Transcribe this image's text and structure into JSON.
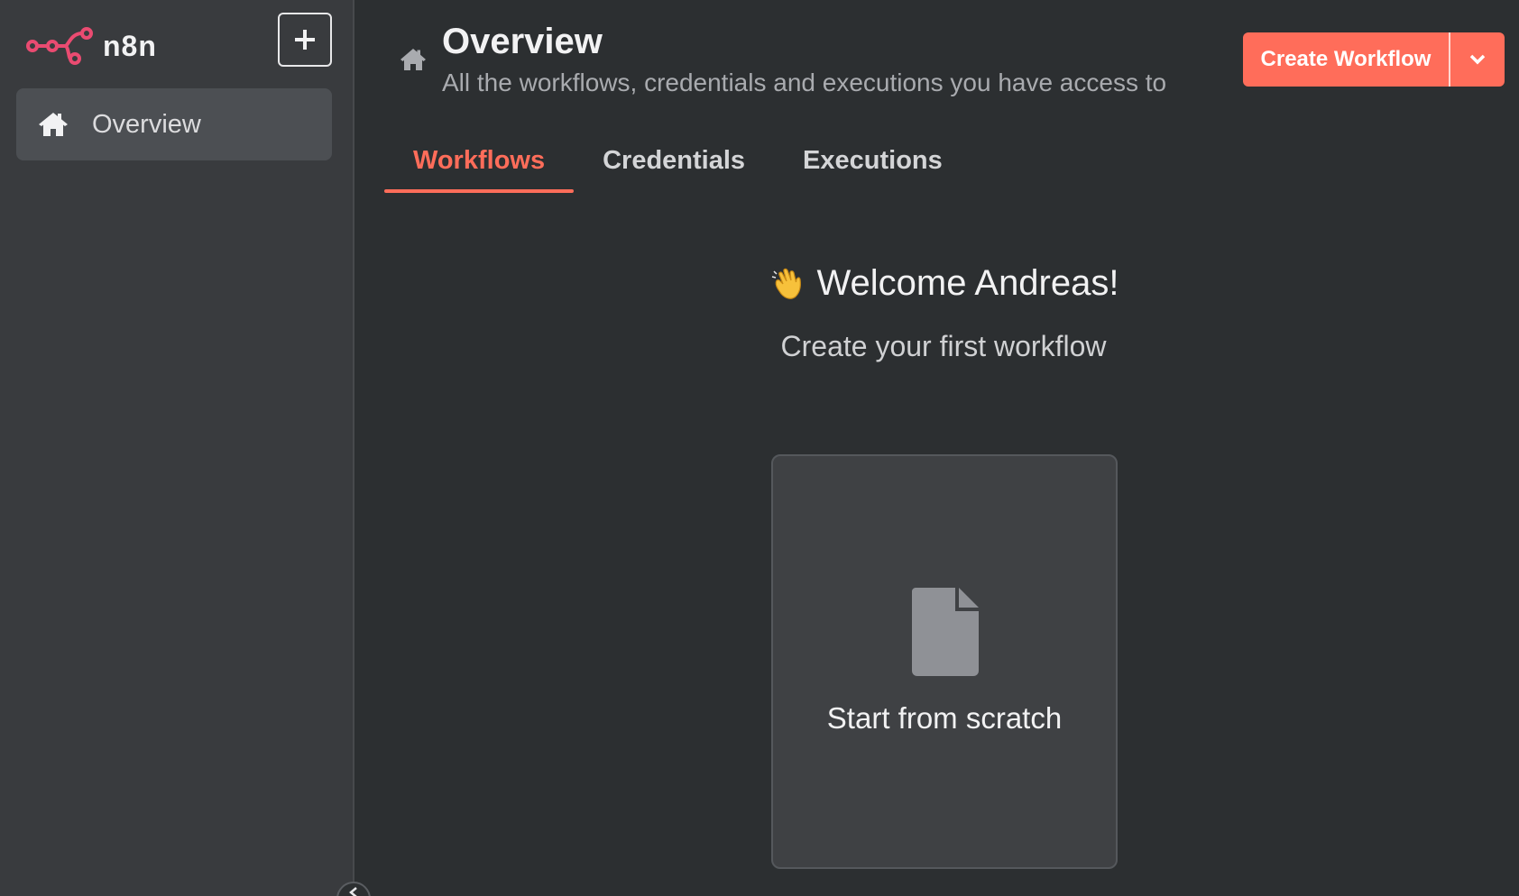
{
  "app": {
    "brand": "n8n",
    "accent": "#ff6d5a"
  },
  "sidebar": {
    "items": [
      {
        "label": "Overview",
        "icon": "home-icon"
      }
    ]
  },
  "header": {
    "title": "Overview",
    "subtitle": "All the workflows, credentials and executions you have access to",
    "create_label": "Create Workflow"
  },
  "tabs": [
    {
      "label": "Workflows",
      "active": true
    },
    {
      "label": "Credentials",
      "active": false
    },
    {
      "label": "Executions",
      "active": false
    }
  ],
  "welcome": {
    "title": "Welcome Andreas!",
    "subtitle": "Create your first workflow"
  },
  "card": {
    "label": "Start from scratch",
    "icon": "file-icon"
  }
}
